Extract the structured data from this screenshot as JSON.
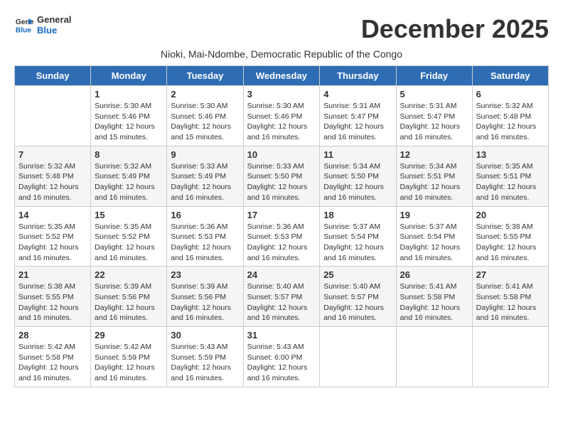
{
  "logo": {
    "line1": "General",
    "line2": "Blue"
  },
  "title": "December 2025",
  "subtitle": "Nioki, Mai-Ndombe, Democratic Republic of the Congo",
  "days_of_week": [
    "Sunday",
    "Monday",
    "Tuesday",
    "Wednesday",
    "Thursday",
    "Friday",
    "Saturday"
  ],
  "weeks": [
    [
      {
        "day": "",
        "info": ""
      },
      {
        "day": "1",
        "info": "Sunrise: 5:30 AM\nSunset: 5:46 PM\nDaylight: 12 hours\nand 15 minutes."
      },
      {
        "day": "2",
        "info": "Sunrise: 5:30 AM\nSunset: 5:46 PM\nDaylight: 12 hours\nand 15 minutes."
      },
      {
        "day": "3",
        "info": "Sunrise: 5:30 AM\nSunset: 5:46 PM\nDaylight: 12 hours\nand 16 minutes."
      },
      {
        "day": "4",
        "info": "Sunrise: 5:31 AM\nSunset: 5:47 PM\nDaylight: 12 hours\nand 16 minutes."
      },
      {
        "day": "5",
        "info": "Sunrise: 5:31 AM\nSunset: 5:47 PM\nDaylight: 12 hours\nand 16 minutes."
      },
      {
        "day": "6",
        "info": "Sunrise: 5:32 AM\nSunset: 5:48 PM\nDaylight: 12 hours\nand 16 minutes."
      }
    ],
    [
      {
        "day": "7",
        "info": "Sunrise: 5:32 AM\nSunset: 5:48 PM\nDaylight: 12 hours\nand 16 minutes."
      },
      {
        "day": "8",
        "info": "Sunrise: 5:32 AM\nSunset: 5:49 PM\nDaylight: 12 hours\nand 16 minutes."
      },
      {
        "day": "9",
        "info": "Sunrise: 5:33 AM\nSunset: 5:49 PM\nDaylight: 12 hours\nand 16 minutes."
      },
      {
        "day": "10",
        "info": "Sunrise: 5:33 AM\nSunset: 5:50 PM\nDaylight: 12 hours\nand 16 minutes."
      },
      {
        "day": "11",
        "info": "Sunrise: 5:34 AM\nSunset: 5:50 PM\nDaylight: 12 hours\nand 16 minutes."
      },
      {
        "day": "12",
        "info": "Sunrise: 5:34 AM\nSunset: 5:51 PM\nDaylight: 12 hours\nand 16 minutes."
      },
      {
        "day": "13",
        "info": "Sunrise: 5:35 AM\nSunset: 5:51 PM\nDaylight: 12 hours\nand 16 minutes."
      }
    ],
    [
      {
        "day": "14",
        "info": "Sunrise: 5:35 AM\nSunset: 5:52 PM\nDaylight: 12 hours\nand 16 minutes."
      },
      {
        "day": "15",
        "info": "Sunrise: 5:35 AM\nSunset: 5:52 PM\nDaylight: 12 hours\nand 16 minutes."
      },
      {
        "day": "16",
        "info": "Sunrise: 5:36 AM\nSunset: 5:53 PM\nDaylight: 12 hours\nand 16 minutes."
      },
      {
        "day": "17",
        "info": "Sunrise: 5:36 AM\nSunset: 5:53 PM\nDaylight: 12 hours\nand 16 minutes."
      },
      {
        "day": "18",
        "info": "Sunrise: 5:37 AM\nSunset: 5:54 PM\nDaylight: 12 hours\nand 16 minutes."
      },
      {
        "day": "19",
        "info": "Sunrise: 5:37 AM\nSunset: 5:54 PM\nDaylight: 12 hours\nand 16 minutes."
      },
      {
        "day": "20",
        "info": "Sunrise: 5:38 AM\nSunset: 5:55 PM\nDaylight: 12 hours\nand 16 minutes."
      }
    ],
    [
      {
        "day": "21",
        "info": "Sunrise: 5:38 AM\nSunset: 5:55 PM\nDaylight: 12 hours\nand 16 minutes."
      },
      {
        "day": "22",
        "info": "Sunrise: 5:39 AM\nSunset: 5:56 PM\nDaylight: 12 hours\nand 16 minutes."
      },
      {
        "day": "23",
        "info": "Sunrise: 5:39 AM\nSunset: 5:56 PM\nDaylight: 12 hours\nand 16 minutes."
      },
      {
        "day": "24",
        "info": "Sunrise: 5:40 AM\nSunset: 5:57 PM\nDaylight: 12 hours\nand 16 minutes."
      },
      {
        "day": "25",
        "info": "Sunrise: 5:40 AM\nSunset: 5:57 PM\nDaylight: 12 hours\nand 16 minutes."
      },
      {
        "day": "26",
        "info": "Sunrise: 5:41 AM\nSunset: 5:58 PM\nDaylight: 12 hours\nand 16 minutes."
      },
      {
        "day": "27",
        "info": "Sunrise: 5:41 AM\nSunset: 5:58 PM\nDaylight: 12 hours\nand 16 minutes."
      }
    ],
    [
      {
        "day": "28",
        "info": "Sunrise: 5:42 AM\nSunset: 5:58 PM\nDaylight: 12 hours\nand 16 minutes."
      },
      {
        "day": "29",
        "info": "Sunrise: 5:42 AM\nSunset: 5:59 PM\nDaylight: 12 hours\nand 16 minutes."
      },
      {
        "day": "30",
        "info": "Sunrise: 5:43 AM\nSunset: 5:59 PM\nDaylight: 12 hours\nand 16 minutes."
      },
      {
        "day": "31",
        "info": "Sunrise: 5:43 AM\nSunset: 6:00 PM\nDaylight: 12 hours\nand 16 minutes."
      },
      {
        "day": "",
        "info": ""
      },
      {
        "day": "",
        "info": ""
      },
      {
        "day": "",
        "info": ""
      }
    ]
  ]
}
